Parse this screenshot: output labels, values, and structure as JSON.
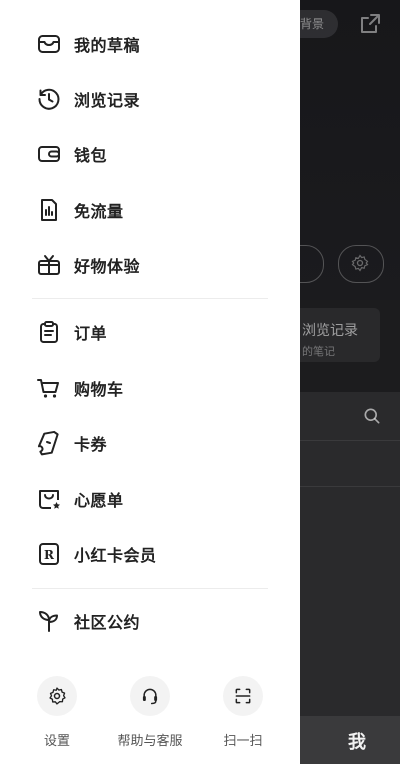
{
  "background": {
    "chip_label": "置背景",
    "card_title": "浏览记录",
    "card_subtitle": "的笔记",
    "tab_me": "我"
  },
  "drawer": {
    "group1": [
      {
        "label": "我的草稿",
        "icon": "drafts-box-icon"
      },
      {
        "label": "浏览记录",
        "icon": "history-clock-icon"
      },
      {
        "label": "钱包",
        "icon": "wallet-icon"
      },
      {
        "label": "免流量",
        "icon": "data-free-icon"
      },
      {
        "label": "好物体验",
        "icon": "gift-tv-icon"
      }
    ],
    "group2": [
      {
        "label": "订单",
        "icon": "clipboard-icon"
      },
      {
        "label": "购物车",
        "icon": "cart-icon"
      },
      {
        "label": "卡券",
        "icon": "ticket-icon"
      },
      {
        "label": "心愿单",
        "icon": "wishlist-bag-icon"
      },
      {
        "label": "小红卡会员",
        "icon": "r-card-icon"
      }
    ],
    "group3": [
      {
        "label": "社区公约",
        "icon": "sprout-icon"
      }
    ],
    "bottom": [
      {
        "label": "设置",
        "icon": "gear-icon"
      },
      {
        "label": "帮助与客服",
        "icon": "headset-icon"
      },
      {
        "label": "扫一扫",
        "icon": "scan-icon"
      }
    ]
  },
  "colors": {
    "drawer_bg": "#ffffff",
    "text": "#222222",
    "overlay": "#1c1c1e"
  }
}
